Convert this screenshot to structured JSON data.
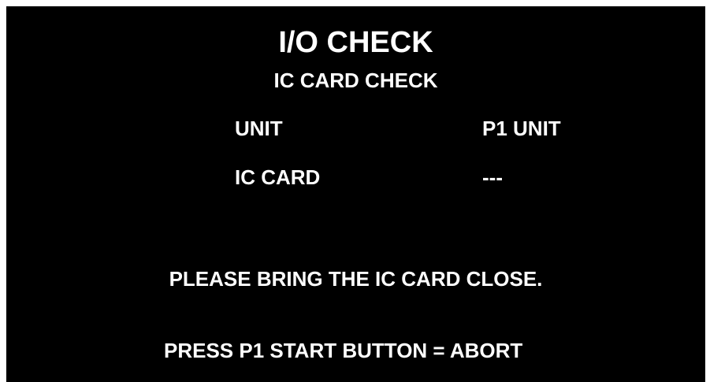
{
  "header": {
    "title": "I/O CHECK",
    "subtitle": "IC CARD CHECK"
  },
  "rows": [
    {
      "label": "UNIT",
      "value": "P1 UNIT"
    },
    {
      "label": "IC CARD",
      "value": "---"
    }
  ],
  "message": "PLEASE BRING THE IC CARD CLOSE.",
  "footer": {
    "abort_hint": "PRESS P1 START BUTTON = ABORT"
  },
  "colors": {
    "background": "#000000",
    "text": "#ffffff",
    "page": "#ffffff"
  }
}
